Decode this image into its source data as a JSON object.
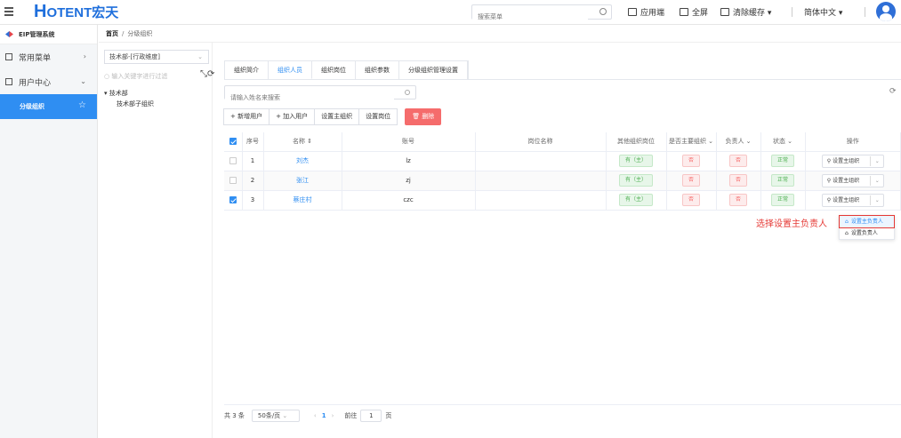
{
  "app": {
    "logo_main": "H",
    "logo_text": "OTENT宏天"
  },
  "header": {
    "search_placeholder": "搜索菜单",
    "tools": [
      "应用端",
      "全屏",
      "清除缓存 ▾",
      "简体中文 ▾"
    ]
  },
  "sidebar": {
    "system_title": "EIP管理系统",
    "items": [
      {
        "label": "常用菜单",
        "chevron": "›"
      },
      {
        "label": "用户中心",
        "chevron": "⌄"
      },
      {
        "label": "分级组织",
        "chevron": "☆"
      }
    ]
  },
  "breadcrumb": {
    "home": "首页",
    "sep": "/",
    "current": "分级组织"
  },
  "tree": {
    "dimension": "技术部-[行政维度]",
    "filter_placeholder": "输入关键字进行过滤",
    "nodes": [
      "▾ 技术部",
      "技术部子组织"
    ]
  },
  "tabs": [
    "组织简介",
    "组织人员",
    "组织岗位",
    "组织参数",
    "分级组织管理设置"
  ],
  "keyword": {
    "placeholder": "请输入姓名来搜索"
  },
  "buttons": {
    "add": "+ 新增用户",
    "join": "+ 加入用户",
    "set_main": "设置主组织",
    "set_post": "设置岗位",
    "delete": "🗑 删除"
  },
  "table": {
    "headers": [
      "序号",
      "名称 ⇕",
      "账号",
      "岗位名称",
      "其他组织岗位",
      "是否主要组织 ⌄",
      "负责人 ⌄",
      "状态 ⌄",
      "操作"
    ],
    "rows": [
      {
        "no": "1",
        "name": "刘杰",
        "account": "lz",
        "post": "",
        "other": "有（主）",
        "main": "否",
        "leader": "否",
        "status": "正常",
        "op": "设置主组织",
        "checked": false
      },
      {
        "no": "2",
        "name": "张江",
        "account": "zj",
        "post": "",
        "other": "有（主）",
        "main": "否",
        "leader": "否",
        "status": "正常",
        "op": "设置主组织",
        "checked": false
      },
      {
        "no": "3",
        "name": "蔡庄村",
        "account": "czc",
        "post": "",
        "other": "有（主）",
        "main": "否",
        "leader": "否",
        "status": "正常",
        "op": "设置主组织",
        "checked": true
      }
    ]
  },
  "dropdown": {
    "items": [
      "设置主负责人",
      "设置负责人"
    ]
  },
  "annotation": "选择设置主负责人",
  "pager": {
    "total": "共 3 条",
    "size": "50条/页",
    "current": "1",
    "goto": "前往",
    "page": "1",
    "suffix": "页"
  }
}
